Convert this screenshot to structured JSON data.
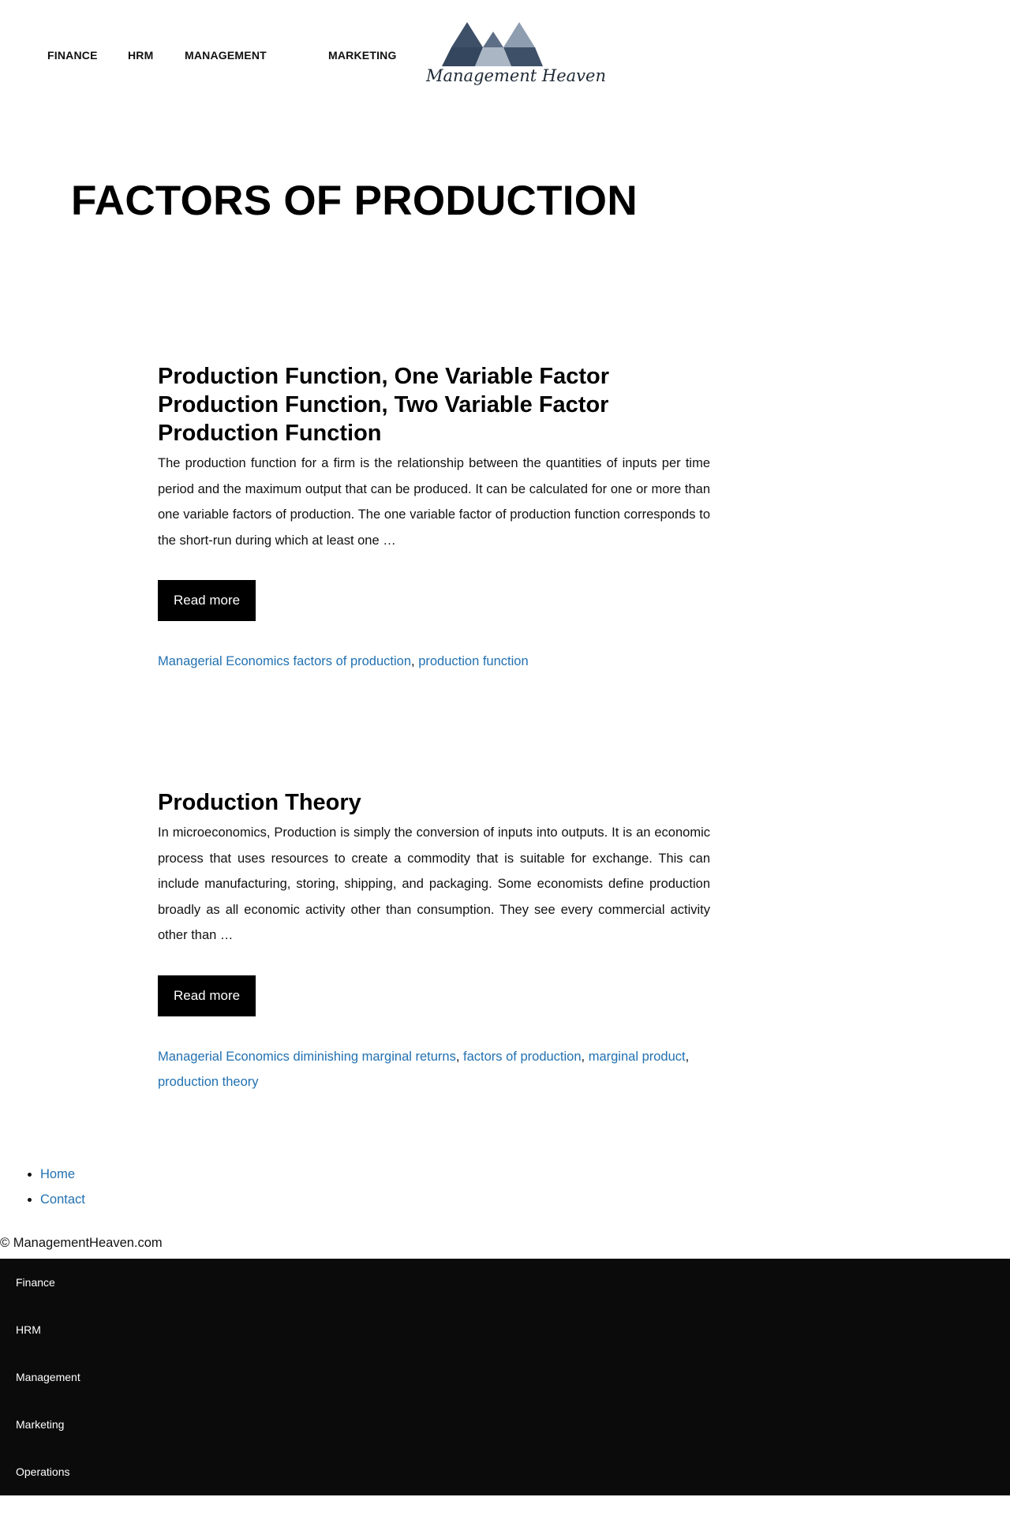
{
  "header": {
    "nav": [
      "FINANCE",
      "HRM",
      "MANAGEMENT",
      "MARKETING"
    ],
    "logo_text": "Management Heaven"
  },
  "archive_title": "FACTORS OF PRODUCTION",
  "posts": [
    {
      "title": "Production Function, One Variable Factor Production Function, Two Variable Factor Production Function",
      "excerpt": "The production function for a firm is the relationship between the quantities of inputs per time period and the maximum output that can be produced. It can be calculated for one or more than one variable factors of production. The one variable factor of production function corresponds to the short-run during which at least one …",
      "read_more": "Read more",
      "category": "Managerial Economics",
      "tags": [
        "factors of production",
        "production function"
      ]
    },
    {
      "title": "Production Theory",
      "excerpt": "In microeconomics, Production is simply the conversion of inputs into outputs. It is an economic process that uses resources to create a commodity that is suitable for exchange. This can include manufacturing, storing, shipping, and packaging. Some economists define production broadly as all economic activity other than consumption. They see every commercial activity other than …",
      "read_more": "Read more",
      "category": "Managerial Economics",
      "tags": [
        "diminishing marginal returns",
        "factors of production",
        "marginal product",
        "production theory"
      ]
    }
  ],
  "footer": {
    "links": [
      "Home",
      "Contact"
    ],
    "copyright": "© ManagementHeaven.com",
    "categories": [
      "Finance",
      "HRM",
      "Management",
      "Marketing",
      "Operations"
    ]
  },
  "colors": {
    "link": "#2271b1",
    "button_bg": "#000000",
    "dark_footer_bg": "#0b0b0b",
    "logo_dark": "#3e5068",
    "logo_light": "#8e9db0"
  }
}
